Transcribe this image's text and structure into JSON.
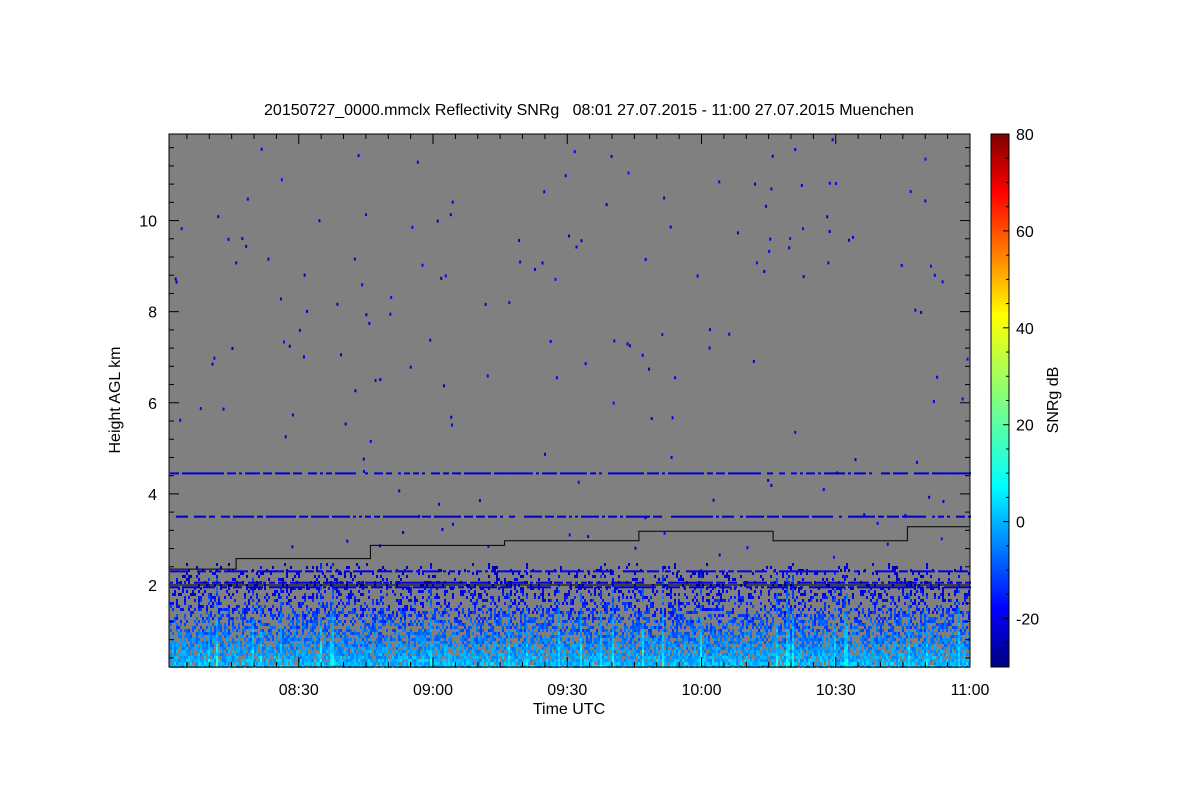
{
  "chart_data": {
    "type": "heatmap",
    "title": "20150727_0000.mmclx Reflectivity SNRg   08:01 27.07.2015 - 11:00 27.07.2015 Muenchen",
    "xlabel": "Time UTC",
    "ylabel": "Height AGL km",
    "x_range": [
      "08:01",
      "11:00"
    ],
    "x_ticks": [
      "08:30",
      "09:00",
      "09:30",
      "10:00",
      "10:30",
      "11:00"
    ],
    "ylim": [
      0.2,
      11.9
    ],
    "y_ticks": [
      2,
      4,
      6,
      8,
      10
    ],
    "background_value": "no signal (grey)",
    "colorbar": {
      "label": "SNRg dB",
      "range": [
        -30,
        80
      ],
      "ticks": [
        -20,
        0,
        20,
        40,
        60,
        80
      ],
      "colormap": "jet"
    },
    "boundary_line": {
      "name": "",
      "x": [
        "08:01",
        "08:16",
        "08:16",
        "08:46",
        "08:46",
        "09:16",
        "09:16",
        "09:46",
        "09:46",
        "10:16",
        "10:16",
        "10:46",
        "10:46",
        "11:00"
      ],
      "y": [
        2.35,
        2.35,
        2.58,
        2.58,
        2.87,
        2.87,
        2.97,
        2.97,
        3.18,
        3.18,
        2.97,
        2.97,
        3.28,
        3.28
      ]
    },
    "reference_lines_km": [
      2.0
    ],
    "signal_layers": [
      {
        "height_km": 4.45,
        "snr_db": -20
      },
      {
        "height_km": 3.5,
        "snr_db": -22
      },
      {
        "height_km": 2.3,
        "snr_db": -18
      },
      {
        "height_km": 2.05,
        "snr_db": -20
      },
      {
        "height_km": 1.95,
        "snr_db": -22
      }
    ],
    "boundary_layer_echo": {
      "top_km": 2.5,
      "surface_snr_db": 10,
      "upper_snr_db": -20
    }
  }
}
